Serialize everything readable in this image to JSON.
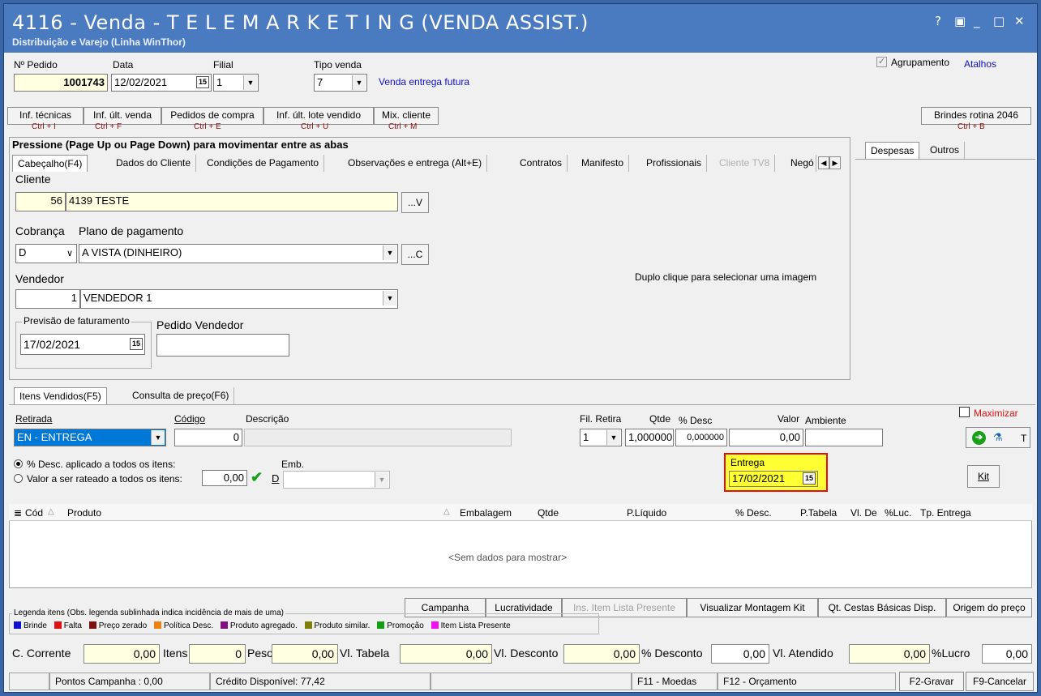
{
  "window": {
    "title": "4116 - Venda - T E L E M A R K E T I N G  (VENDA ASSIST.)",
    "subtitle": "Distribuição e Varejo (Linha WinThor)",
    "controls": {
      "help": "?",
      "restore": "▣",
      "minimize": "_",
      "maximize": "□",
      "close": "✕"
    }
  },
  "header": {
    "pedido_label": "Nº Pedido",
    "pedido_value": "1001743",
    "data_label": "Data",
    "data_value": "12/02/2021",
    "filial_label": "Filial",
    "filial_value": "1",
    "tipo_venda_label": "Tipo venda",
    "tipo_venda_value": "7",
    "tipo_venda_desc": "Venda entrega futura",
    "agrupamento_label": "Agrupamento",
    "atalhos_label": "Atalhos"
  },
  "toolbar": [
    {
      "label": "Inf. técnicas",
      "shortcut": "Ctrl + I"
    },
    {
      "label": "Inf. últ. venda",
      "shortcut": "Ctrl + F"
    },
    {
      "label": "Pedidos de compra",
      "shortcut": "Ctrl + E"
    },
    {
      "label": "Inf. últ. lote vendido",
      "shortcut": "Ctrl + U"
    },
    {
      "label": "Mix. cliente",
      "shortcut": "Ctrl + M"
    }
  ],
  "brindes": {
    "label": "Brindes rotina 2046",
    "shortcut": "Ctrl + B"
  },
  "tabs_note": "Pressione (Page Up ou Page Down) para movimentar entre as abas",
  "main_tabs": [
    "Cabeçalho(F4)",
    "Dados do Cliente",
    "Condições de Pagamento",
    "Observações e entrega (Alt+E)",
    "Contratos",
    "Manifesto",
    "Profissionais",
    "Cliente TV8",
    "Negó"
  ],
  "side_tabs": [
    "Despesas",
    "Outros"
  ],
  "cabecalho": {
    "cliente_label": "Cliente",
    "cliente_code": "56",
    "cliente_name": "4139 TESTE",
    "cliente_btn": "...V",
    "cobranca_label": "Cobrança",
    "cobranca_value": "D",
    "plano_label": "Plano de pagamento",
    "plano_value": "A VISTA (DINHEIRO)",
    "plano_btn": "...C",
    "vendedor_label": "Vendedor",
    "vendedor_code": "1",
    "vendedor_name": "VENDEDOR 1",
    "previsao_label": "Previsão de faturamento",
    "previsao_value": "17/02/2021",
    "pedido_vendedor_label": "Pedido Vendedor",
    "image_hint": "Duplo clique para selecionar uma imagem"
  },
  "item_tabs": [
    "Itens Vendidos(F5)",
    "Consulta de preço(F6)"
  ],
  "items_form": {
    "retirada_label": "Retirada",
    "retirada_value": "EN - ENTREGA",
    "codigo_label": "Código",
    "codigo_value": "0",
    "descricao_label": "Descrição",
    "fil_retira_label": "Fil. Retira",
    "fil_retira_value": "1",
    "qtde_label": "Qtde",
    "qtde_value": "1,000000",
    "desc_label": "% Desc",
    "desc_value": "0,000000",
    "valor_label": "Valor",
    "valor_value": "0,00",
    "ambiente_label": "Ambiente",
    "maximizar_label": "Maximizar",
    "radio1": "% Desc. aplicado a todos os itens:",
    "radio2": "Valor a ser rateado a todos os itens:",
    "rateio_value": "0,00",
    "d_btn": "D",
    "emb_label": "Emb.",
    "entrega_label": "Entrega",
    "entrega_value": "17/02/2021",
    "kit_btn": "Kit",
    "t_btn": "T"
  },
  "grid": {
    "columns": [
      "Cód",
      "Produto",
      "Embalagem",
      "Qtde",
      "P.Líquido",
      "% Desc.",
      "P.Tabela",
      "Vl. De",
      "%Luc.",
      "Tp. Entrega"
    ],
    "empty": "<Sem dados para mostrar>"
  },
  "grid_buttons": [
    "Campanha",
    "Lucratividade",
    "Ins. Item Lista Presente",
    "Visualizar Montagem Kit",
    "Qt. Cestas Básicas Disp.",
    "Origem do preço"
  ],
  "legend": {
    "title": "Legenda itens (Obs. legenda sublinhada indica incidência de mais de uma)",
    "items": [
      {
        "label": "Brinde",
        "color": "#1010d0"
      },
      {
        "label": "Falta",
        "color": "#e01010"
      },
      {
        "label": "Preço zerado",
        "color": "#801010"
      },
      {
        "label": "Política Desc.",
        "color": "#f08010"
      },
      {
        "label": "Produto agregado.",
        "color": "#801080"
      },
      {
        "label": "Produto similar.",
        "color": "#808000"
      },
      {
        "label": "Promoção",
        "color": "#10a010"
      },
      {
        "label": "Item Lista Presente",
        "color": "#f010f0"
      }
    ]
  },
  "totals": {
    "c_corrente_label": "C. Corrente",
    "c_corrente": "0,00",
    "itens_label": "Itens",
    "itens": "0",
    "peso_label": "Peso",
    "peso": "0,00",
    "vl_tabela_label": "Vl. Tabela",
    "vl_tabela": "0,00",
    "vl_desconto_label": "Vl. Desconto",
    "vl_desconto": "0,00",
    "pct_desconto_label": "% Desconto",
    "pct_desconto": "0,00",
    "vl_atendido_label": "Vl. Atendido",
    "vl_atendido": "0,00",
    "pct_lucro_label": "%Lucro",
    "pct_lucro": "0,00"
  },
  "status": {
    "pontos": "Pontos Campanha : 0,00",
    "credito": "Crédito Disponível: 77,42",
    "f11": "F11 - Moedas",
    "f12": "F12 - Orçamento",
    "gravar": "F2-Gravar",
    "cancelar": "F9-Cancelar"
  },
  "colors": {
    "title_bar": "#4a7bc0",
    "highlight": "#0078d7",
    "entrega_border": "#e01010",
    "entrega_fill": "#ffff33"
  }
}
